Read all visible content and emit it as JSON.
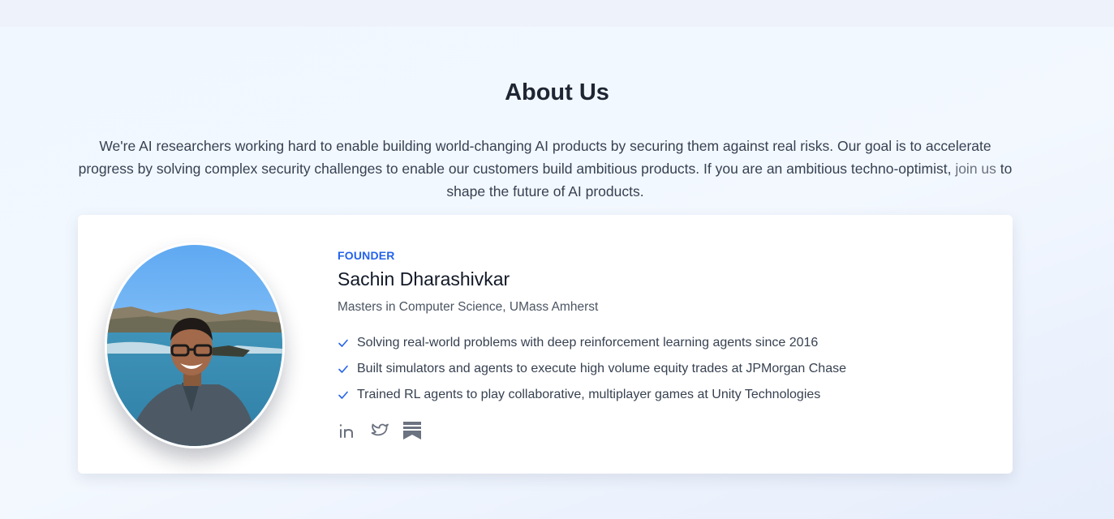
{
  "about": {
    "title": "About Us",
    "intro_before": "We're AI researchers working hard to enable building world-changing AI products by securing them against real risks. Our goal is to accelerate progress by solving complex security challenges to enable our customers build ambitious products. If you are an ambitious techno-optimist, ",
    "join_link": "join us",
    "intro_after": " to shape the future of AI products."
  },
  "founder": {
    "role": "FOUNDER",
    "name": "Sachin Dharashivkar",
    "degree": "Masters in Computer Science, UMass Amherst",
    "photo_icon": "founder-photo",
    "achievements": [
      "Solving real-world problems with deep reinforcement learning agents since 2016",
      "Built simulators and agents to execute high volume equity trades at JPMorgan Chase",
      "Trained RL agents to play collaborative, multiplayer games at Unity Technologies"
    ],
    "socials": [
      "linkedin-icon",
      "twitter-icon",
      "bookmark-icon"
    ]
  },
  "colors": {
    "accent": "#2563eb",
    "heading": "#1f2633",
    "body_text": "#374151",
    "link": "#6b7280",
    "icon": "#6b7280"
  }
}
